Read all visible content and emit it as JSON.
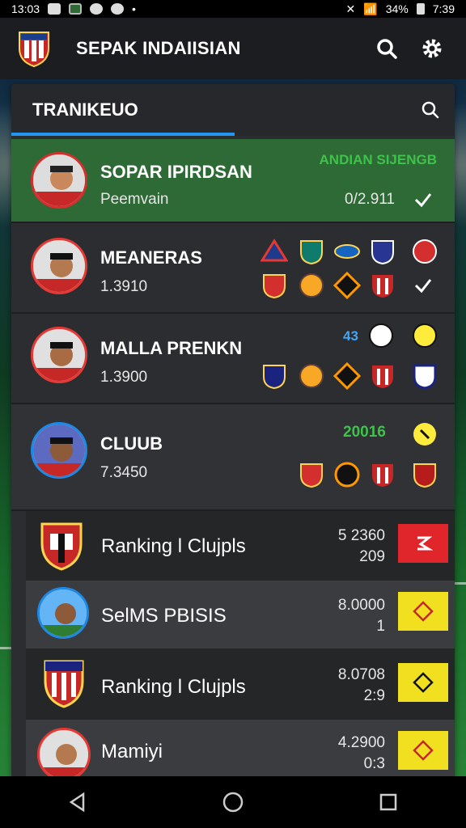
{
  "status": {
    "time_left": "13:03",
    "battery": "34%",
    "time_right": "7:39"
  },
  "header": {
    "title": "SEPAK INDAIISIAN"
  },
  "panel": {
    "title": "TRANIKEUO"
  },
  "players": [
    {
      "name": "SOPAR IPIRDSAN",
      "sub": "Peemvain",
      "tag": "ANDIAN SIJENGB",
      "value": "0/2.911"
    },
    {
      "name": "MEANERAS",
      "sub": "1.3910"
    },
    {
      "name": "MALLA PRENKN",
      "sub": "1.3900",
      "tag": "43"
    },
    {
      "name": "CLUUB",
      "sub": "7.3450",
      "tag": "20016"
    }
  ],
  "clubs": [
    {
      "name": "Ranking l Clujpls",
      "v1": "5 2360",
      "v2": "209",
      "button_color": "#e0262b"
    },
    {
      "name": "SelMS PBISIS",
      "v1": "8.0000",
      "v2": "1",
      "button_color": "#f0e020"
    },
    {
      "name": "Ranking l Clujpls",
      "v1": "8.0708",
      "v2": "2:9",
      "button_color": "#f0e020"
    },
    {
      "name": "Mamiyi",
      "v1": "4.2900",
      "v2": "0:3",
      "button_color": "#f0e020"
    }
  ],
  "colors": {
    "accent": "#2196f3",
    "highlight": "#2e6a35",
    "tag_green": "#3ec24a"
  }
}
